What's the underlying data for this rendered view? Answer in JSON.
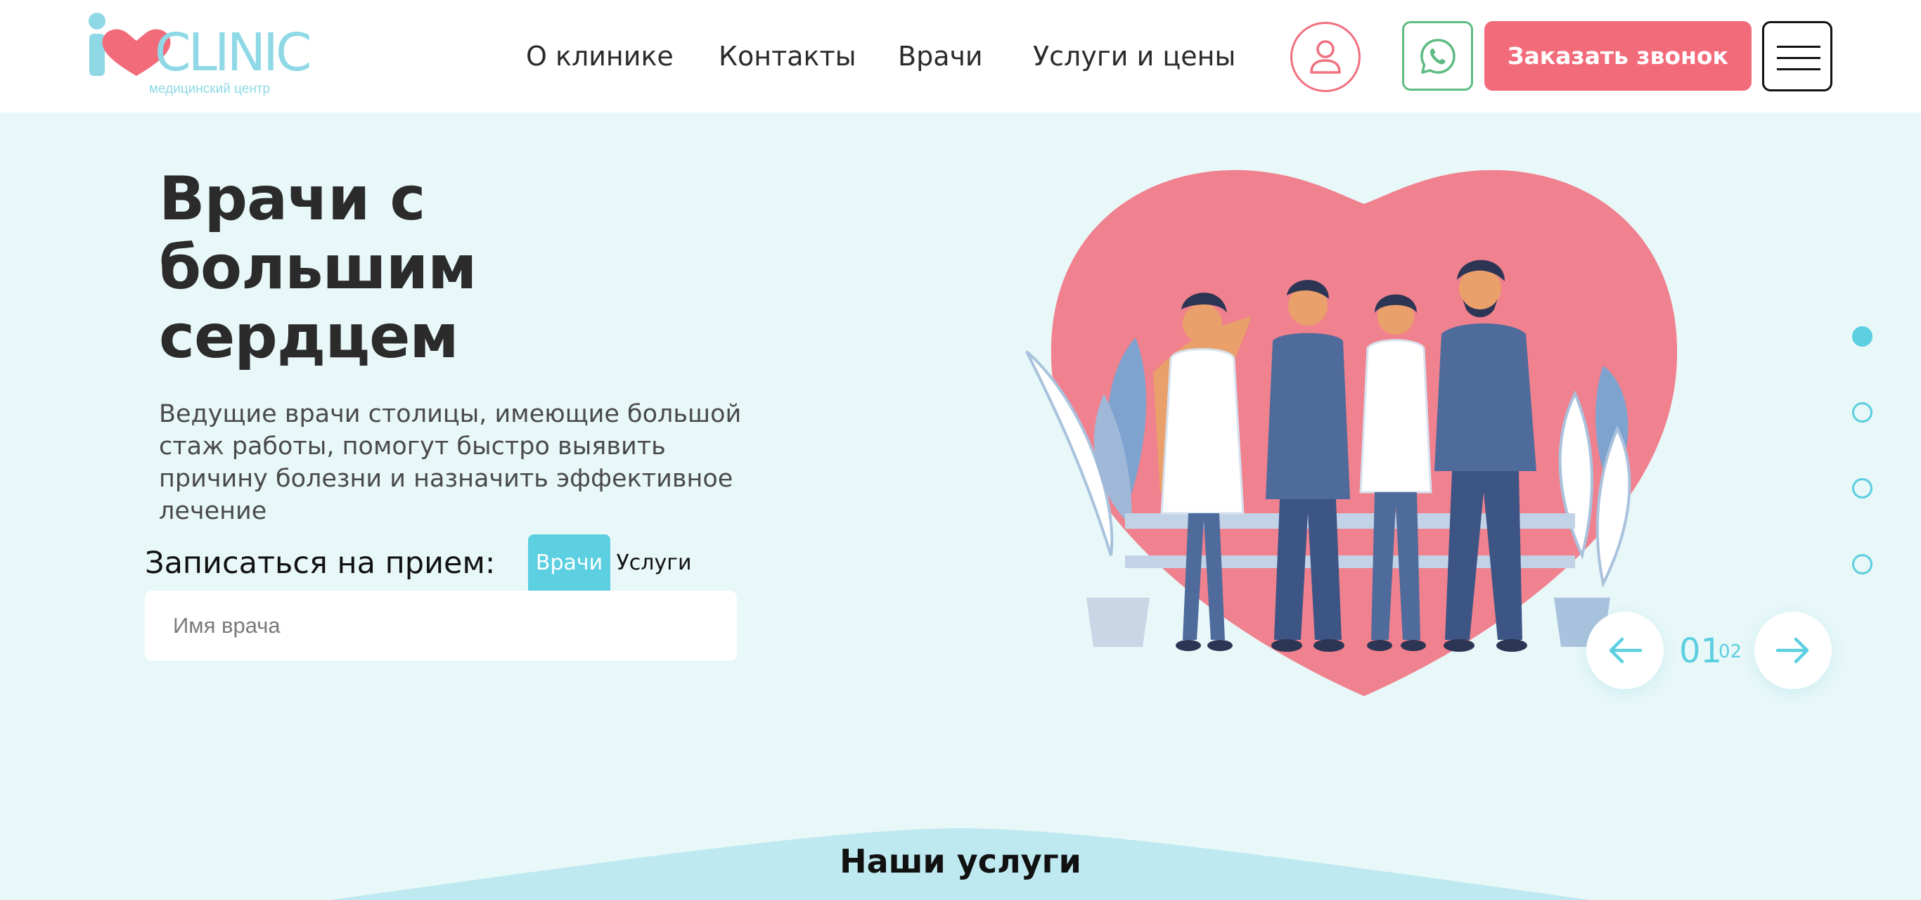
{
  "brand": {
    "logo_text": "CLINIC",
    "tagline": "медицинский центр"
  },
  "nav": {
    "items": [
      {
        "label": "О клинике"
      },
      {
        "label": "Контакты"
      },
      {
        "label": "Врачи"
      },
      {
        "label": "Услуги и цены"
      }
    ]
  },
  "header_actions": {
    "profile_icon": "user-icon",
    "whatsapp_icon": "whatsapp-icon",
    "callback_label": "Заказать звонок",
    "menu_icon": "hamburger-menu-icon"
  },
  "hero": {
    "title": "Врачи с большим сердцем",
    "description": "Ведущие врачи столицы, имеющие большой стаж работы, помогут быстро выявить причину болезни и назначить эффективное лечение"
  },
  "booking": {
    "label": "Записаться на прием:",
    "tabs": [
      {
        "label": "Врачи",
        "active": true
      },
      {
        "label": "Услуги",
        "active": false
      }
    ],
    "search_placeholder": "Имя врача"
  },
  "slider": {
    "current": "01",
    "total": "02",
    "dots": [
      {
        "active": true
      },
      {
        "active": false
      },
      {
        "active": false
      },
      {
        "active": false
      }
    ]
  },
  "services": {
    "title": "Наши услуги"
  },
  "colors": {
    "accent_pink": "#f26b7b",
    "accent_cyan": "#5ccfe0",
    "whatsapp_green": "#5fbb83",
    "hero_background": "#e8f7f8"
  }
}
